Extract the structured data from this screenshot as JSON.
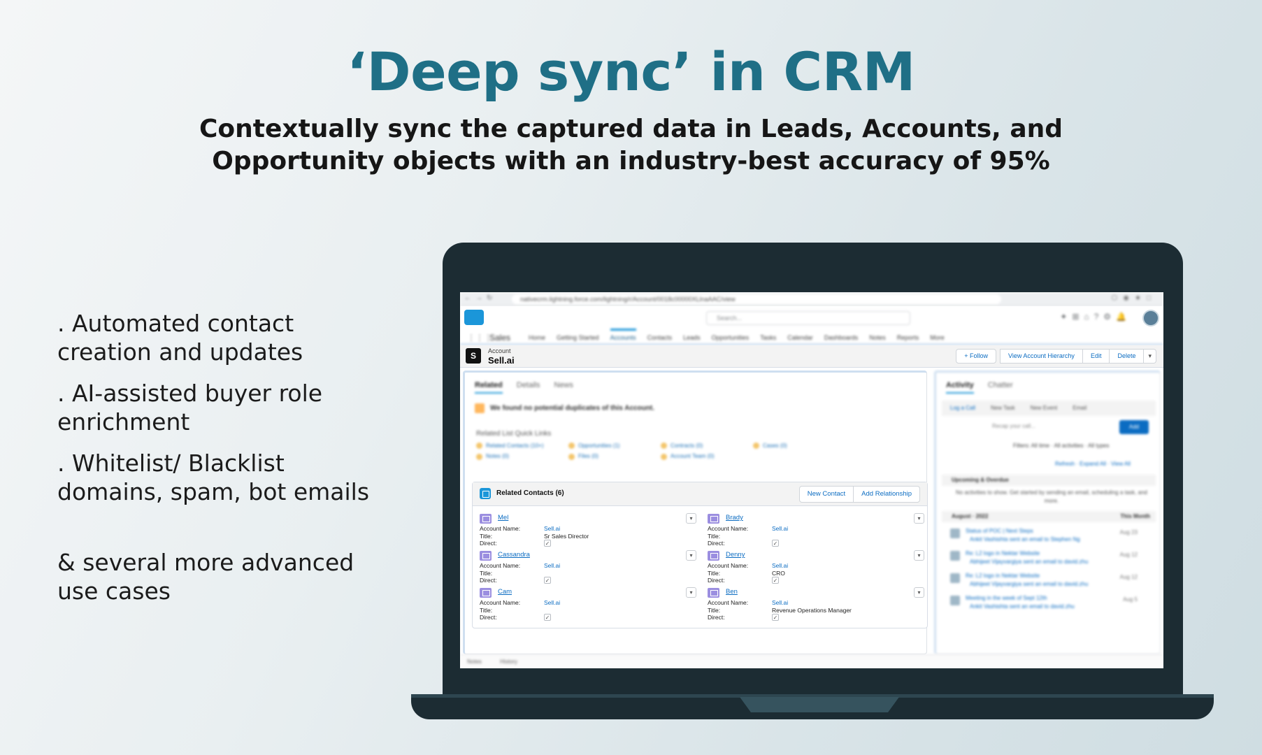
{
  "headline": "‘Deep sync’ in CRM",
  "subhead": "Contextually sync the captured data in Leads, Accounts, and Opportunity objects with an industry-best accuracy of 95%",
  "features": [
    ". Automated contact creation and updates",
    ". AI-assisted buyer role enrichment",
    ". Whitelist/ Blacklist domains, spam, bot emails"
  ],
  "more_text": "& several more advanced use cases",
  "browser": {
    "url": "nativecrm.lightning.force.com/lightning/r/Account/0018c00000XLlnaAAC/view"
  },
  "app_header": {
    "search_placeholder": "Search..."
  },
  "nav": {
    "app_name": "Sales",
    "items": [
      "Home",
      "Getting Started",
      "Accounts",
      "Contacts",
      "Leads",
      "Opportunities",
      "Tasks",
      "Calendar",
      "Dashboards",
      "Notes",
      "Reports",
      "More"
    ]
  },
  "record": {
    "type": "Account",
    "name": "Sell.ai",
    "icon_letter": "S",
    "actions": [
      "+ Follow",
      "View Account Hierarchy",
      "Edit",
      "Delete",
      "▾"
    ]
  },
  "left_panel": {
    "tabs": [
      "Related",
      "Details",
      "News"
    ],
    "duplicate_message": "We found no potential duplicates of this Account.",
    "quick_links_title": "Related List Quick Links",
    "quick_links": [
      "Related Contacts (10+)",
      "Opportunities (1)",
      "Contracts (0)",
      "Cases (0)",
      "Notes (0)",
      "Files (0)",
      "Account Team (0)"
    ]
  },
  "related_contacts": {
    "title": "Related Contacts (6)",
    "new_contact_label": "New Contact",
    "add_relationship_label": "Add Relationship",
    "field_labels": {
      "account_name": "Account Name:",
      "title": "Title:",
      "direct": "Direct:"
    },
    "contacts": [
      {
        "name": "Mel",
        "account": "Sell.ai",
        "title": "Sr Sales Director"
      },
      {
        "name": "Brady",
        "account": "Sell.ai",
        "title": ""
      },
      {
        "name": "Cassandra",
        "account": "Sell.ai",
        "title": ""
      },
      {
        "name": "Denny",
        "account": "Sell.ai",
        "title": "CRO"
      },
      {
        "name": "Cam",
        "account": "Sell.ai",
        "title": ""
      },
      {
        "name": "Ben",
        "account": "Sell.ai",
        "title": "Revenue Operations Manager"
      }
    ]
  },
  "activity_panel": {
    "tabs": [
      "Activity",
      "Chatter"
    ],
    "subtabs": [
      "Log a Call",
      "New Task",
      "New Event",
      "Email"
    ],
    "input_placeholder": "Recap your call...",
    "add_label": "Add",
    "filter_text": "Filters: All time · All activities · All types",
    "links_text": "Refresh · Expand All · View All",
    "upcoming_title": "Upcoming & Overdue",
    "upcoming_note": "No activities to show. Get started by sending an email, scheduling a task, and more.",
    "month_title": "August · 2022",
    "month_badge": "This Month",
    "items": [
      {
        "title": "Status of POC | Next Steps",
        "sub": "Ankit Vashishta sent an email to Stephen Ng",
        "date": "Aug 23"
      },
      {
        "title": "Re: L2 logo in Nektar Website",
        "sub": "Abhijeet Vijayvargiya sent an email to david.zhu",
        "date": "Aug 12"
      },
      {
        "title": "Re: L2 logo in Nektar Website",
        "sub": "Abhijeet Vijayvargiya sent an email to david.zhu",
        "date": "Aug 12"
      },
      {
        "title": "Meeting in the week of Sept 12th",
        "sub": "Ankit Vashishta sent an email to david.zhu",
        "date": "Aug 5"
      }
    ]
  },
  "footer": {
    "items": [
      "Notes",
      "History"
    ]
  }
}
